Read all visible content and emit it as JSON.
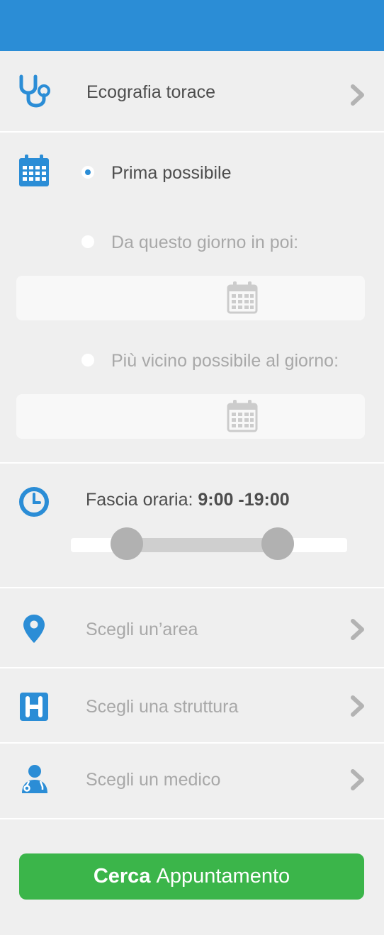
{
  "exam": {
    "label": "Ecografia torace"
  },
  "date_options": {
    "asap_label": "Prima possibile",
    "from_day_label": "Da questo giorno in poi:",
    "closest_day_label": "Più vicino possibile al giorno:",
    "selected": "asap"
  },
  "time_range": {
    "label_prefix": "Fascia oraria:",
    "value": "9:00 -19:00",
    "start_fraction": 0.204,
    "end_fraction": 0.749
  },
  "area": {
    "placeholder": "Scegli un’area"
  },
  "facility": {
    "placeholder": "Scegli una struttura"
  },
  "doctor": {
    "placeholder": "Scegli un medico"
  },
  "search_button": {
    "bold": "Cerca",
    "rest": "Appuntamento"
  },
  "colors": {
    "header": "#2b8dd6",
    "accent": "#2b8dd6",
    "cta": "#3bb54a",
    "background": "#efefef"
  },
  "icons": {
    "exam": "stethoscope-icon",
    "date": "calendar-icon",
    "time": "clock-icon",
    "area": "map-pin-icon",
    "facility": "hospital-icon",
    "doctor": "doctor-icon",
    "chevron": "chevron-right-icon"
  }
}
